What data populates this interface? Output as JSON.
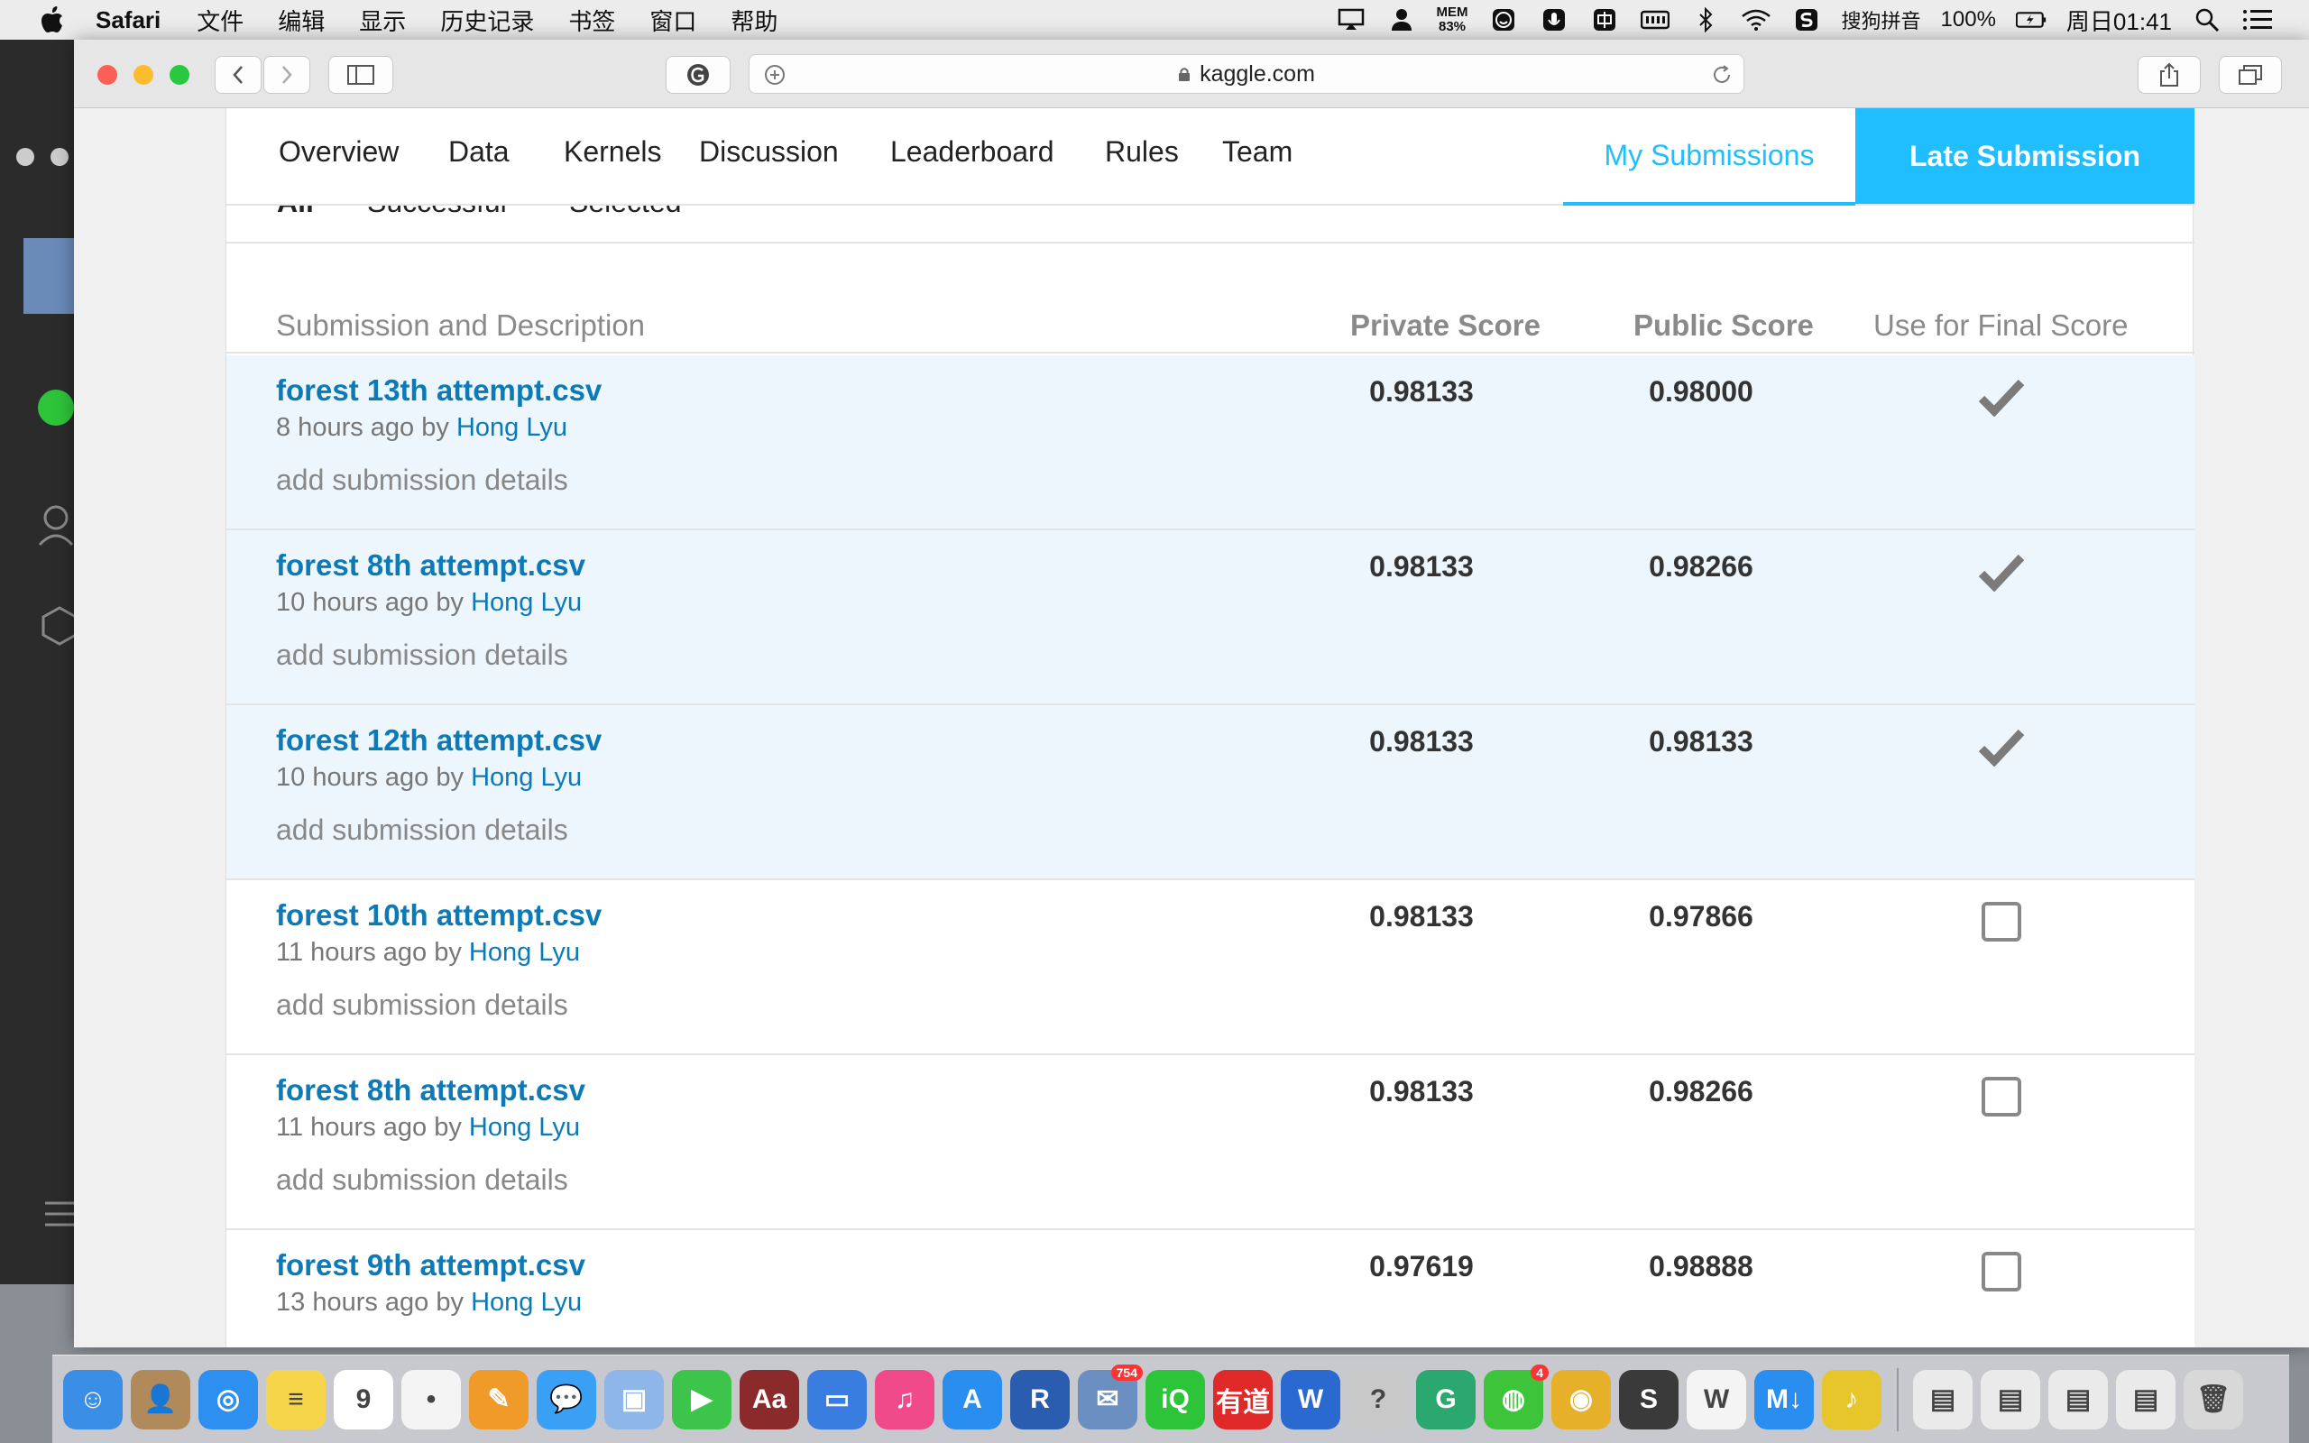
{
  "menubar": {
    "app_name": "Safari",
    "items": [
      "文件",
      "编辑",
      "显示",
      "历史记录",
      "书签",
      "窗口",
      "帮助"
    ],
    "mem_label": "MEM",
    "mem_value": "83%",
    "input_method": "搜狗拼音",
    "battery": "100%",
    "clock": "周日01:41"
  },
  "browser": {
    "url": "kaggle.com"
  },
  "nav": {
    "tabs": [
      "Overview",
      "Data",
      "Kernels",
      "Discussion",
      "Leaderboard",
      "Rules",
      "Team"
    ],
    "my_submissions": "My Submissions",
    "late_submission": "Late Submission"
  },
  "subtabs": [
    "All",
    "Successful",
    "Selected"
  ],
  "table": {
    "headers": {
      "description": "Submission and Description",
      "private": "Private Score",
      "public": "Public Score",
      "final": "Use for Final Score"
    },
    "by_label": "by",
    "rows": [
      {
        "file": "forest 13th attempt.csv",
        "time": "8 hours ago",
        "author": "Hong Lyu",
        "details": "add submission details",
        "private": "0.98133",
        "public": "0.98000",
        "selected": true
      },
      {
        "file": "forest 8th attempt.csv",
        "time": "10 hours ago",
        "author": "Hong Lyu",
        "details": "add submission details",
        "private": "0.98133",
        "public": "0.98266",
        "selected": true
      },
      {
        "file": "forest 12th attempt.csv",
        "time": "10 hours ago",
        "author": "Hong Lyu",
        "details": "add submission details",
        "private": "0.98133",
        "public": "0.98133",
        "selected": true
      },
      {
        "file": "forest 10th attempt.csv",
        "time": "11 hours ago",
        "author": "Hong Lyu",
        "details": "add submission details",
        "private": "0.98133",
        "public": "0.97866",
        "selected": false
      },
      {
        "file": "forest 8th attempt.csv",
        "time": "11 hours ago",
        "author": "Hong Lyu",
        "details": "add submission details",
        "private": "0.98133",
        "public": "0.98266",
        "selected": false
      },
      {
        "file": "forest 9th attempt.csv",
        "time": "13 hours ago",
        "author": "Hong Lyu",
        "details": "",
        "private": "0.97619",
        "public": "0.98888",
        "selected": false
      }
    ]
  },
  "dock": {
    "icons": [
      {
        "name": "finder",
        "color": "#3a8ee6",
        "glyph": "☺"
      },
      {
        "name": "contacts",
        "color": "#b08a5a",
        "glyph": "👤"
      },
      {
        "name": "safari",
        "color": "#2d8ff0",
        "glyph": "◎"
      },
      {
        "name": "notes",
        "color": "#f7d54a",
        "glyph": "≡"
      },
      {
        "name": "calendar",
        "color": "#ffffff",
        "glyph": "9"
      },
      {
        "name": "reminders",
        "color": "#f4f4f4",
        "glyph": "•"
      },
      {
        "name": "pages",
        "color": "#f09a2a",
        "glyph": "✎"
      },
      {
        "name": "messages",
        "color": "#3aa0f5",
        "glyph": "💬"
      },
      {
        "name": "preview",
        "color": "#8fb6e8",
        "glyph": "▣"
      },
      {
        "name": "facetime",
        "color": "#3cc54a",
        "glyph": "▶"
      },
      {
        "name": "dictionary",
        "color": "#8b2a2a",
        "glyph": "Aa"
      },
      {
        "name": "keynote",
        "color": "#3a7de0",
        "glyph": "▭"
      },
      {
        "name": "itunes",
        "color": "#f04a8a",
        "glyph": "♫"
      },
      {
        "name": "app-store",
        "color": "#2a8ef0",
        "glyph": "A"
      },
      {
        "name": "r",
        "color": "#2a5db0",
        "glyph": "R"
      },
      {
        "name": "mail",
        "color": "#6a8fc0",
        "glyph": "✉",
        "badge": "754"
      },
      {
        "name": "iqiyi",
        "color": "#2ec43a",
        "glyph": "iQ"
      },
      {
        "name": "youdao",
        "color": "#e02a2a",
        "glyph": "有道"
      },
      {
        "name": "word",
        "color": "#2a6ad0",
        "glyph": "W"
      },
      {
        "name": "help",
        "color": "#c8c8c8",
        "glyph": "?"
      },
      {
        "name": "grammarly",
        "color": "#2aa870",
        "glyph": "G"
      },
      {
        "name": "wechat",
        "color": "#3ec43a",
        "glyph": "◍",
        "badge": "4"
      },
      {
        "name": "chrome",
        "color": "#e6b02a",
        "glyph": "◉"
      },
      {
        "name": "sublime",
        "color": "#3a3a3a",
        "glyph": "S"
      },
      {
        "name": "wunderlist",
        "color": "#f4f4f4",
        "glyph": "W"
      },
      {
        "name": "markdown",
        "color": "#2a8ef0",
        "glyph": "M↓"
      },
      {
        "name": "music",
        "color": "#e6c62a",
        "glyph": "♪"
      },
      {
        "name": "document-1",
        "color": "#eaeaea",
        "glyph": "▤"
      },
      {
        "name": "document-2",
        "color": "#eaeaea",
        "glyph": "▤"
      },
      {
        "name": "document-3",
        "color": "#eaeaea",
        "glyph": "▤"
      },
      {
        "name": "document-4",
        "color": "#eaeaea",
        "glyph": "▤"
      },
      {
        "name": "trash",
        "color": "#d8d8d8",
        "glyph": "🗑"
      }
    ]
  }
}
